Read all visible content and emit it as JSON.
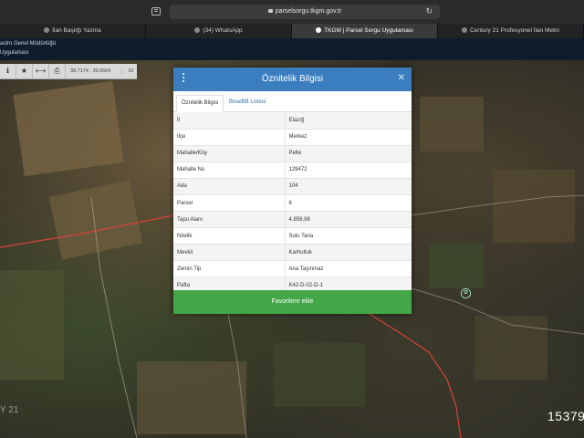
{
  "browser": {
    "url": "parselsorgu.tkgm.gov.tr",
    "tabs": [
      {
        "label": "İlan Başlığı Yazma"
      },
      {
        "label": "(34) WhatsApp"
      },
      {
        "label": "TKGM | Parsel Sorgu Uygulaması"
      },
      {
        "label": "Century 21 Profesyonel İlan Metni"
      }
    ]
  },
  "site_header": {
    "line1": "astro Genel Müdürlüğü",
    "line2": "Uygulaması"
  },
  "map_toolbar": {
    "coords": "38.7174 : 39.0604",
    "zoom": "16"
  },
  "map": {
    "poi_label": "...",
    "bottom_logo": "Y 21",
    "count": "15379"
  },
  "modal": {
    "title": "Öznitelik Bilgisi",
    "tabs": [
      "Öznitelik Bilgisi",
      "Bina/BB Listesi"
    ],
    "rows": [
      {
        "key": "İl",
        "value": "Elazığ"
      },
      {
        "key": "İlçe",
        "value": "Merkez"
      },
      {
        "key": "Mahalle/Köy",
        "value": "Pelte"
      },
      {
        "key": "Mahalle No",
        "value": "129472"
      },
      {
        "key": "Ada",
        "value": "104"
      },
      {
        "key": "Parsel",
        "value": "6"
      },
      {
        "key": "Tapu Alanı",
        "value": "4.859,98"
      },
      {
        "key": "Nitelik",
        "value": "Sulu Tarla"
      },
      {
        "key": "Mevkii",
        "value": "Karhutluk"
      },
      {
        "key": "Zemin Tip",
        "value": "Ana Taşınmaz"
      },
      {
        "key": "Pafta",
        "value": "K42-D-02-D-1"
      }
    ],
    "favorite_button": "Favorilere ekle"
  },
  "colors": {
    "header_blue": "#3a7ec0",
    "button_green": "#43a747",
    "parcel_line": "#e23b3b"
  }
}
